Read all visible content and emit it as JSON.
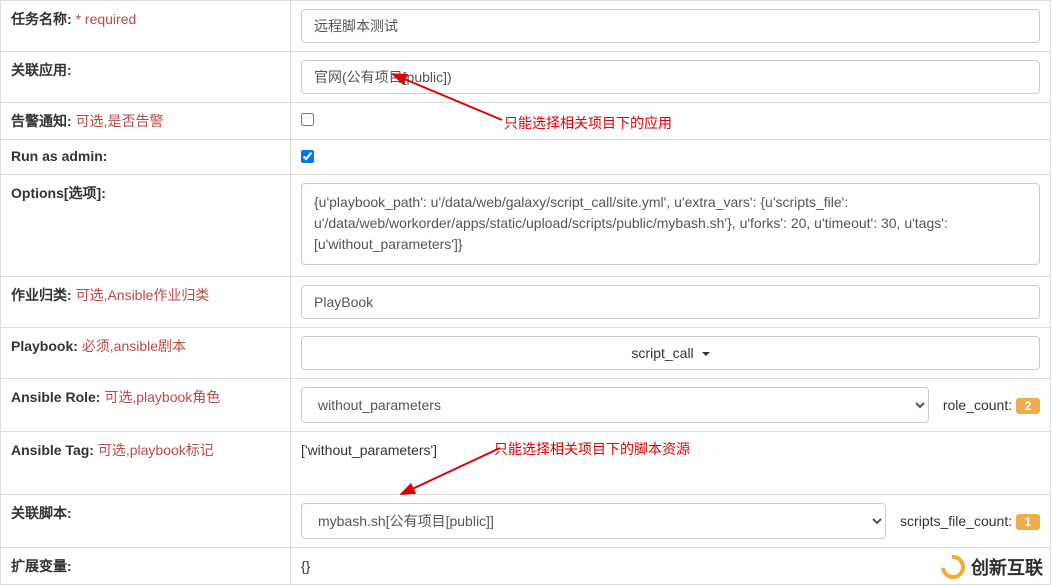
{
  "rows": {
    "task_name": {
      "label": "任务名称:",
      "note": "* required",
      "value": "远程脚本测试"
    },
    "assoc_app": {
      "label": "关联应用:",
      "value": "官网(公有项目[public])"
    },
    "alert": {
      "label": "告警通知:",
      "note": "可选,是否告警",
      "checked": false
    },
    "run_admin": {
      "label": "Run as admin:",
      "checked": true
    },
    "options": {
      "label": "Options[选项]:",
      "value": "{u'playbook_path': u'/data/web/galaxy/script_call/site.yml', u'extra_vars': {u'scripts_file': u'/data/web/workorder/apps/static/upload/scripts/public/mybash.sh'}, u'forks': 20, u'timeout': 30, u'tags': [u'without_parameters']}"
    },
    "job_class": {
      "label": "作业归类:",
      "note": "可选,Ansible作业归类",
      "value": "PlayBook"
    },
    "playbook": {
      "label": "Playbook:",
      "note": "必须,ansible剧本",
      "value": "script_call"
    },
    "ansible_role": {
      "label": "Ansible Role:",
      "note": "可选,playbook角色",
      "value": "without_parameters",
      "side_label": "role_count:",
      "side_value": "2"
    },
    "ansible_tag": {
      "label": "Ansible Tag:",
      "note": "可选,playbook标记",
      "value": "['without_parameters']"
    },
    "assoc_script": {
      "label": "关联脚本:",
      "value": "mybash.sh[公有项目[public]]",
      "side_label": "scripts_file_count:",
      "side_value": "1"
    },
    "ext_vars": {
      "label": "扩展变量:",
      "value": "{}"
    }
  },
  "annotations": {
    "app_note": "只能选择相关项目下的应用",
    "script_note": "只能选择相关项目下的脚本资源"
  },
  "watermark": "创新互联"
}
